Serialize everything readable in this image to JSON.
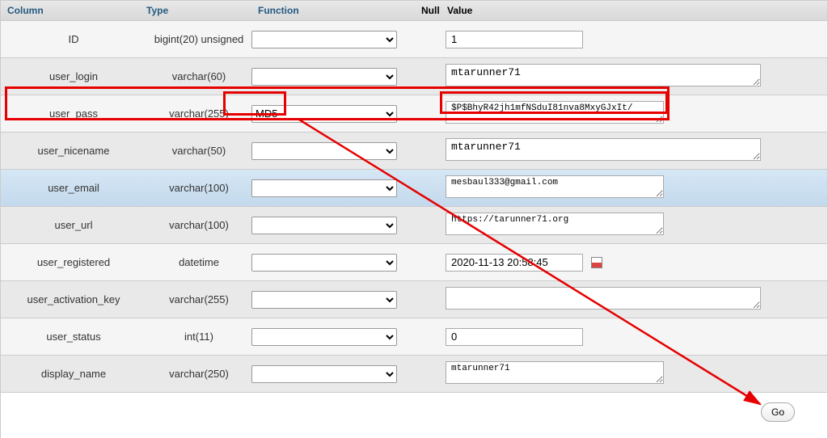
{
  "header": {
    "column_label": "Column",
    "type_label": "Type",
    "function_label": "Function",
    "null_label": "Null",
    "value_label": "Value"
  },
  "rows": [
    {
      "column": "ID",
      "type": "bigint(20) unsigned",
      "function": "",
      "value": "1"
    },
    {
      "column": "user_login",
      "type": "varchar(60)",
      "function": "",
      "value": "mtarunner71"
    },
    {
      "column": "user_pass",
      "type": "varchar(255)",
      "function": "MD5",
      "value": "$P$BhyR42jh1mfNSduI81nva8MxyGJxIt/"
    },
    {
      "column": "user_nicename",
      "type": "varchar(50)",
      "function": "",
      "value": "mtarunner71"
    },
    {
      "column": "user_email",
      "type": "varchar(100)",
      "function": "",
      "value": "mesbaul333@gmail.com"
    },
    {
      "column": "user_url",
      "type": "varchar(100)",
      "function": "",
      "value": "https://tarunner71.org"
    },
    {
      "column": "user_registered",
      "type": "datetime",
      "function": "",
      "value": "2020-11-13 20:58:45"
    },
    {
      "column": "user_activation_key",
      "type": "varchar(255)",
      "function": "",
      "value": ""
    },
    {
      "column": "user_status",
      "type": "int(11)",
      "function": "",
      "value": "0"
    },
    {
      "column": "display_name",
      "type": "varchar(250)",
      "function": "",
      "value": "mtarunner71"
    }
  ],
  "go_label": "Go"
}
